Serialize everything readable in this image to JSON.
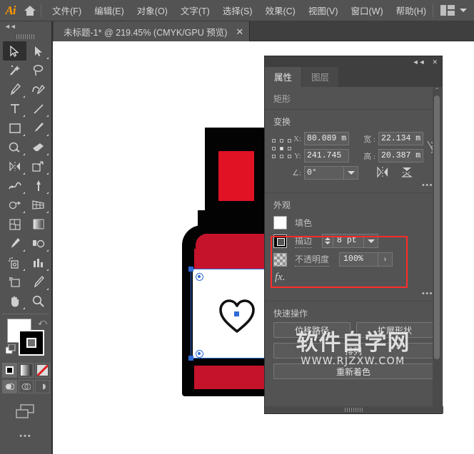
{
  "app": {
    "logo": "Ai",
    "home_icon": "home-icon"
  },
  "menubar": {
    "items": [
      "文件(F)",
      "编辑(E)",
      "对象(O)",
      "文字(T)",
      "选择(S)",
      "效果(C)",
      "视图(V)",
      "窗口(W)",
      "帮助(H)"
    ],
    "workspace_icon": "workspace-switcher-icon",
    "workspace_chevron": "chevron-down-icon"
  },
  "tabbar": {
    "document_title": "未标题-1* @ 219.45% (CMYK/GPU 预览)",
    "close_label": "✕"
  },
  "toolbar": {
    "collapse_label": "◄◄",
    "tools": [
      {
        "name": "selection-tool",
        "selected": true
      },
      {
        "name": "direct-selection-tool",
        "selected": false
      },
      {
        "name": "magic-wand-tool",
        "selected": false
      },
      {
        "name": "lasso-tool",
        "selected": false
      },
      {
        "name": "pen-tool",
        "selected": false
      },
      {
        "name": "curvature-tool",
        "selected": false
      },
      {
        "name": "type-tool",
        "selected": false
      },
      {
        "name": "line-segment-tool",
        "selected": false
      },
      {
        "name": "rectangle-tool",
        "selected": false
      },
      {
        "name": "paintbrush-tool",
        "selected": false
      },
      {
        "name": "shaper-tool",
        "selected": false
      },
      {
        "name": "eraser-tool",
        "selected": false
      },
      {
        "name": "rotate-tool",
        "selected": false
      },
      {
        "name": "scale-tool",
        "selected": false
      },
      {
        "name": "width-tool",
        "selected": false
      },
      {
        "name": "free-transform-tool",
        "selected": false
      },
      {
        "name": "shape-builder-tool",
        "selected": false
      },
      {
        "name": "perspective-grid-tool",
        "selected": false
      },
      {
        "name": "mesh-tool",
        "selected": false
      },
      {
        "name": "gradient-tool",
        "selected": false
      },
      {
        "name": "eyedropper-tool",
        "selected": false
      },
      {
        "name": "blend-tool",
        "selected": false
      },
      {
        "name": "symbol-sprayer-tool",
        "selected": false
      },
      {
        "name": "column-graph-tool",
        "selected": false
      },
      {
        "name": "artboard-tool",
        "selected": false
      },
      {
        "name": "slice-tool",
        "selected": false
      },
      {
        "name": "hand-tool",
        "selected": false
      },
      {
        "name": "zoom-tool",
        "selected": false
      }
    ],
    "fill_color": "#ffffff",
    "stroke_color": "#000000",
    "paint_modes": [
      "solid-color",
      "gradient",
      "none"
    ],
    "screen_modes": [
      "draw-normal",
      "draw-behind",
      "draw-inside"
    ],
    "more_tools": "•••"
  },
  "canvas": {
    "artwork_name": "nail-polish-bottle",
    "colors": {
      "black": "#030303",
      "red": "#c6132c",
      "cap_red": "#e01224",
      "label": "#ffffff"
    },
    "selection_color": "#2f6bd8"
  },
  "panel": {
    "collapse_icon": "collapse-panel-icon",
    "close_icon": "close-panel-icon",
    "tabs": [
      {
        "label": "属性",
        "active": true
      },
      {
        "label": "图层",
        "active": false
      }
    ],
    "object_type": "矩形",
    "transform": {
      "heading": "变换",
      "reference_point": "reference-point-grid",
      "x_label": "X:",
      "x_value": "80.089 m",
      "y_label": "Y:",
      "y_value": "241.745",
      "w_label": "宽 :",
      "w_value": "22.134 m",
      "h_label": "高 :",
      "h_value": "20.387 m",
      "link_icon": "constrain-proportions-unlinked-icon",
      "angle_label": "∠:",
      "angle_value": "0°",
      "angle_dropdown": "chevron-down-icon",
      "flip_horizontal": "flip-horizontal-icon",
      "flip_vertical": "flip-vertical-icon",
      "more": "•••"
    },
    "appearance": {
      "heading": "外观",
      "highlight_color": "#ff2b2b",
      "fill_label": "填色",
      "fill_swatch": "#ffffff",
      "stroke_label": "描边",
      "stroke_swatch": "#000000",
      "stroke_weight": "8 pt",
      "stroke_dropdown": "chevron-down-icon",
      "opacity_label": "不透明度",
      "opacity_value": "100%",
      "opacity_arrow": "›",
      "fx_label": "fx.",
      "more": "•••"
    },
    "quick_actions": {
      "heading": "快速操作",
      "buttons": [
        "位移路径",
        "扩展形状",
        "排列",
        "重新着色"
      ]
    }
  },
  "watermark": {
    "line1": "软件自学网",
    "line2": "WWW.RJZXW.COM"
  }
}
